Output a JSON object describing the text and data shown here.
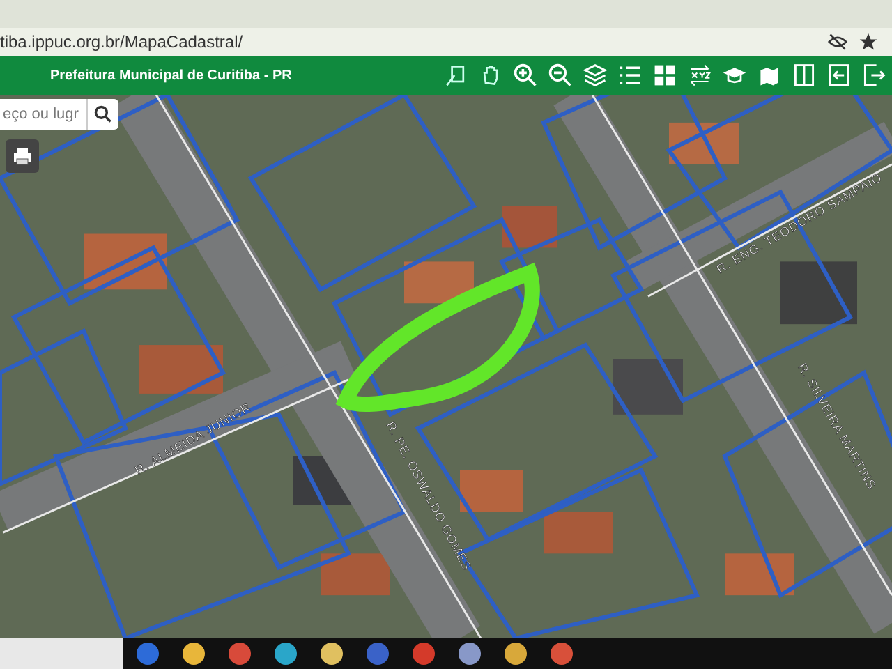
{
  "browser": {
    "url": "tiba.ippuc.org.br/MapaCadastral/"
  },
  "header": {
    "title": "Prefeitura Municipal de Curitiba - PR"
  },
  "search": {
    "placeholder": "eço ou lugr"
  },
  "map": {
    "street_labels": [
      {
        "text": "R. ALMEIDA JUNIOR"
      },
      {
        "text": "R. PE. OSWALDO GOMES"
      },
      {
        "text": "R. ENG. TEODORO SAMPAIO"
      },
      {
        "text": "R. SILVEIRA MARTINS"
      }
    ]
  }
}
